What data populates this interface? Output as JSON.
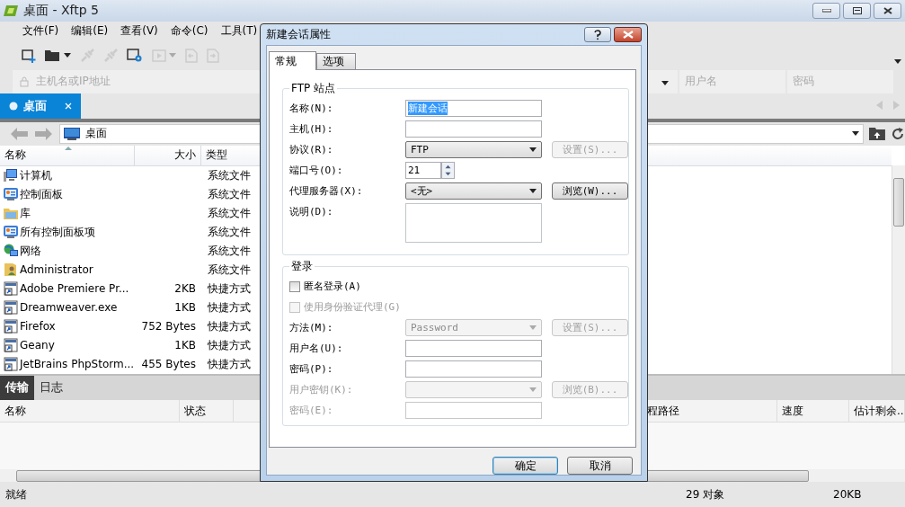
{
  "window": {
    "title": "桌面 - Xftp 5"
  },
  "menu": [
    "文件(F)",
    "编辑(E)",
    "查看(V)",
    "命令(C)",
    "工具(T)"
  ],
  "address_bar": {
    "host_placeholder": "主机名或IP地址",
    "username_placeholder": "用户名",
    "password_placeholder": "密码"
  },
  "tabs": [
    {
      "label": "桌面",
      "selected": true
    }
  ],
  "path": "桌面",
  "file_list": {
    "columns": [
      "名称",
      "大小",
      "类型"
    ],
    "rows": [
      {
        "kind": "computer",
        "name": "计算机",
        "size": "",
        "type": "系统文件"
      },
      {
        "kind": "control_panel",
        "name": "控制面板",
        "size": "",
        "type": "系统文件"
      },
      {
        "kind": "library",
        "name": "库",
        "size": "",
        "type": "系统文件"
      },
      {
        "kind": "control_panel",
        "name": "所有控制面板项",
        "size": "",
        "type": "系统文件"
      },
      {
        "kind": "network",
        "name": "网络",
        "size": "",
        "type": "系统文件"
      },
      {
        "kind": "user_folder",
        "name": "Administrator",
        "size": "",
        "type": "系统文件"
      },
      {
        "kind": "shortcut",
        "name": "Adobe Premiere Pr...",
        "size": "2KB",
        "type": "快捷方式"
      },
      {
        "kind": "shortcut",
        "name": "Dreamweaver.exe",
        "size": "1KB",
        "type": "快捷方式"
      },
      {
        "kind": "shortcut",
        "name": "Firefox",
        "size": "752 Bytes",
        "type": "快捷方式"
      },
      {
        "kind": "shortcut",
        "name": "Geany",
        "size": "1KB",
        "type": "快捷方式"
      },
      {
        "kind": "shortcut",
        "name": "JetBrains PhpStorm...",
        "size": "455 Bytes",
        "type": "快捷方式"
      }
    ]
  },
  "bottom_tabs": [
    {
      "label": "传输",
      "selected": true
    },
    {
      "label": "日志",
      "selected": false
    }
  ],
  "transfer_columns": [
    "名称",
    "状态",
    "程路径",
    "速度",
    "估计剩余..."
  ],
  "status_bar": {
    "message": "就绪",
    "objects": "29 对象",
    "size": "20KB"
  },
  "dialog": {
    "title": "新建会话属性",
    "tabs": [
      {
        "label": "常规",
        "selected": true
      },
      {
        "label": "选项",
        "selected": false
      }
    ],
    "site_group": {
      "title": "FTP 站点",
      "fields": [
        {
          "kind": "text",
          "label": "名称(N):",
          "value": "新建会话",
          "selected": true,
          "disabled": false
        },
        {
          "kind": "text",
          "label": "主机(H):",
          "disabled": false
        },
        {
          "kind": "select",
          "label": "协议(R):",
          "value": "FTP",
          "disabled": false,
          "button": {
            "label": "设置(S)...",
            "disabled": true
          }
        },
        {
          "kind": "spin",
          "label": "端口号(O):",
          "value": "21",
          "disabled": false
        },
        {
          "kind": "select",
          "label": "代理服务器(X):",
          "value": "<无>",
          "disabled": false,
          "button": {
            "label": "浏览(W)...",
            "disabled": false
          }
        },
        {
          "kind": "textarea",
          "label": "说明(D):",
          "disabled": false
        }
      ]
    },
    "login_group": {
      "title": "登录",
      "checkboxes": [
        {
          "label": "匿名登录(A)",
          "checked": false,
          "disabled": false
        },
        {
          "label": "使用身份验证代理(G)",
          "checked": false,
          "disabled": true
        }
      ],
      "fields": [
        {
          "kind": "select",
          "label": "方法(M):",
          "value": "Password",
          "disabled": false,
          "editable": false,
          "button": {
            "label": "设置(S)...",
            "disabled": true
          }
        },
        {
          "kind": "text",
          "label": "用户名(U):",
          "disabled": false
        },
        {
          "kind": "text",
          "label": "密码(P):",
          "disabled": false
        },
        {
          "kind": "select",
          "label": "用户密钥(K):",
          "disabled": true,
          "button": {
            "label": "浏览(B)...",
            "disabled": true
          }
        },
        {
          "kind": "text",
          "label": "密码(E):",
          "disabled": true
        }
      ]
    },
    "buttons": [
      {
        "label": "确定",
        "default": true
      },
      {
        "label": "取消",
        "default": false
      }
    ]
  }
}
